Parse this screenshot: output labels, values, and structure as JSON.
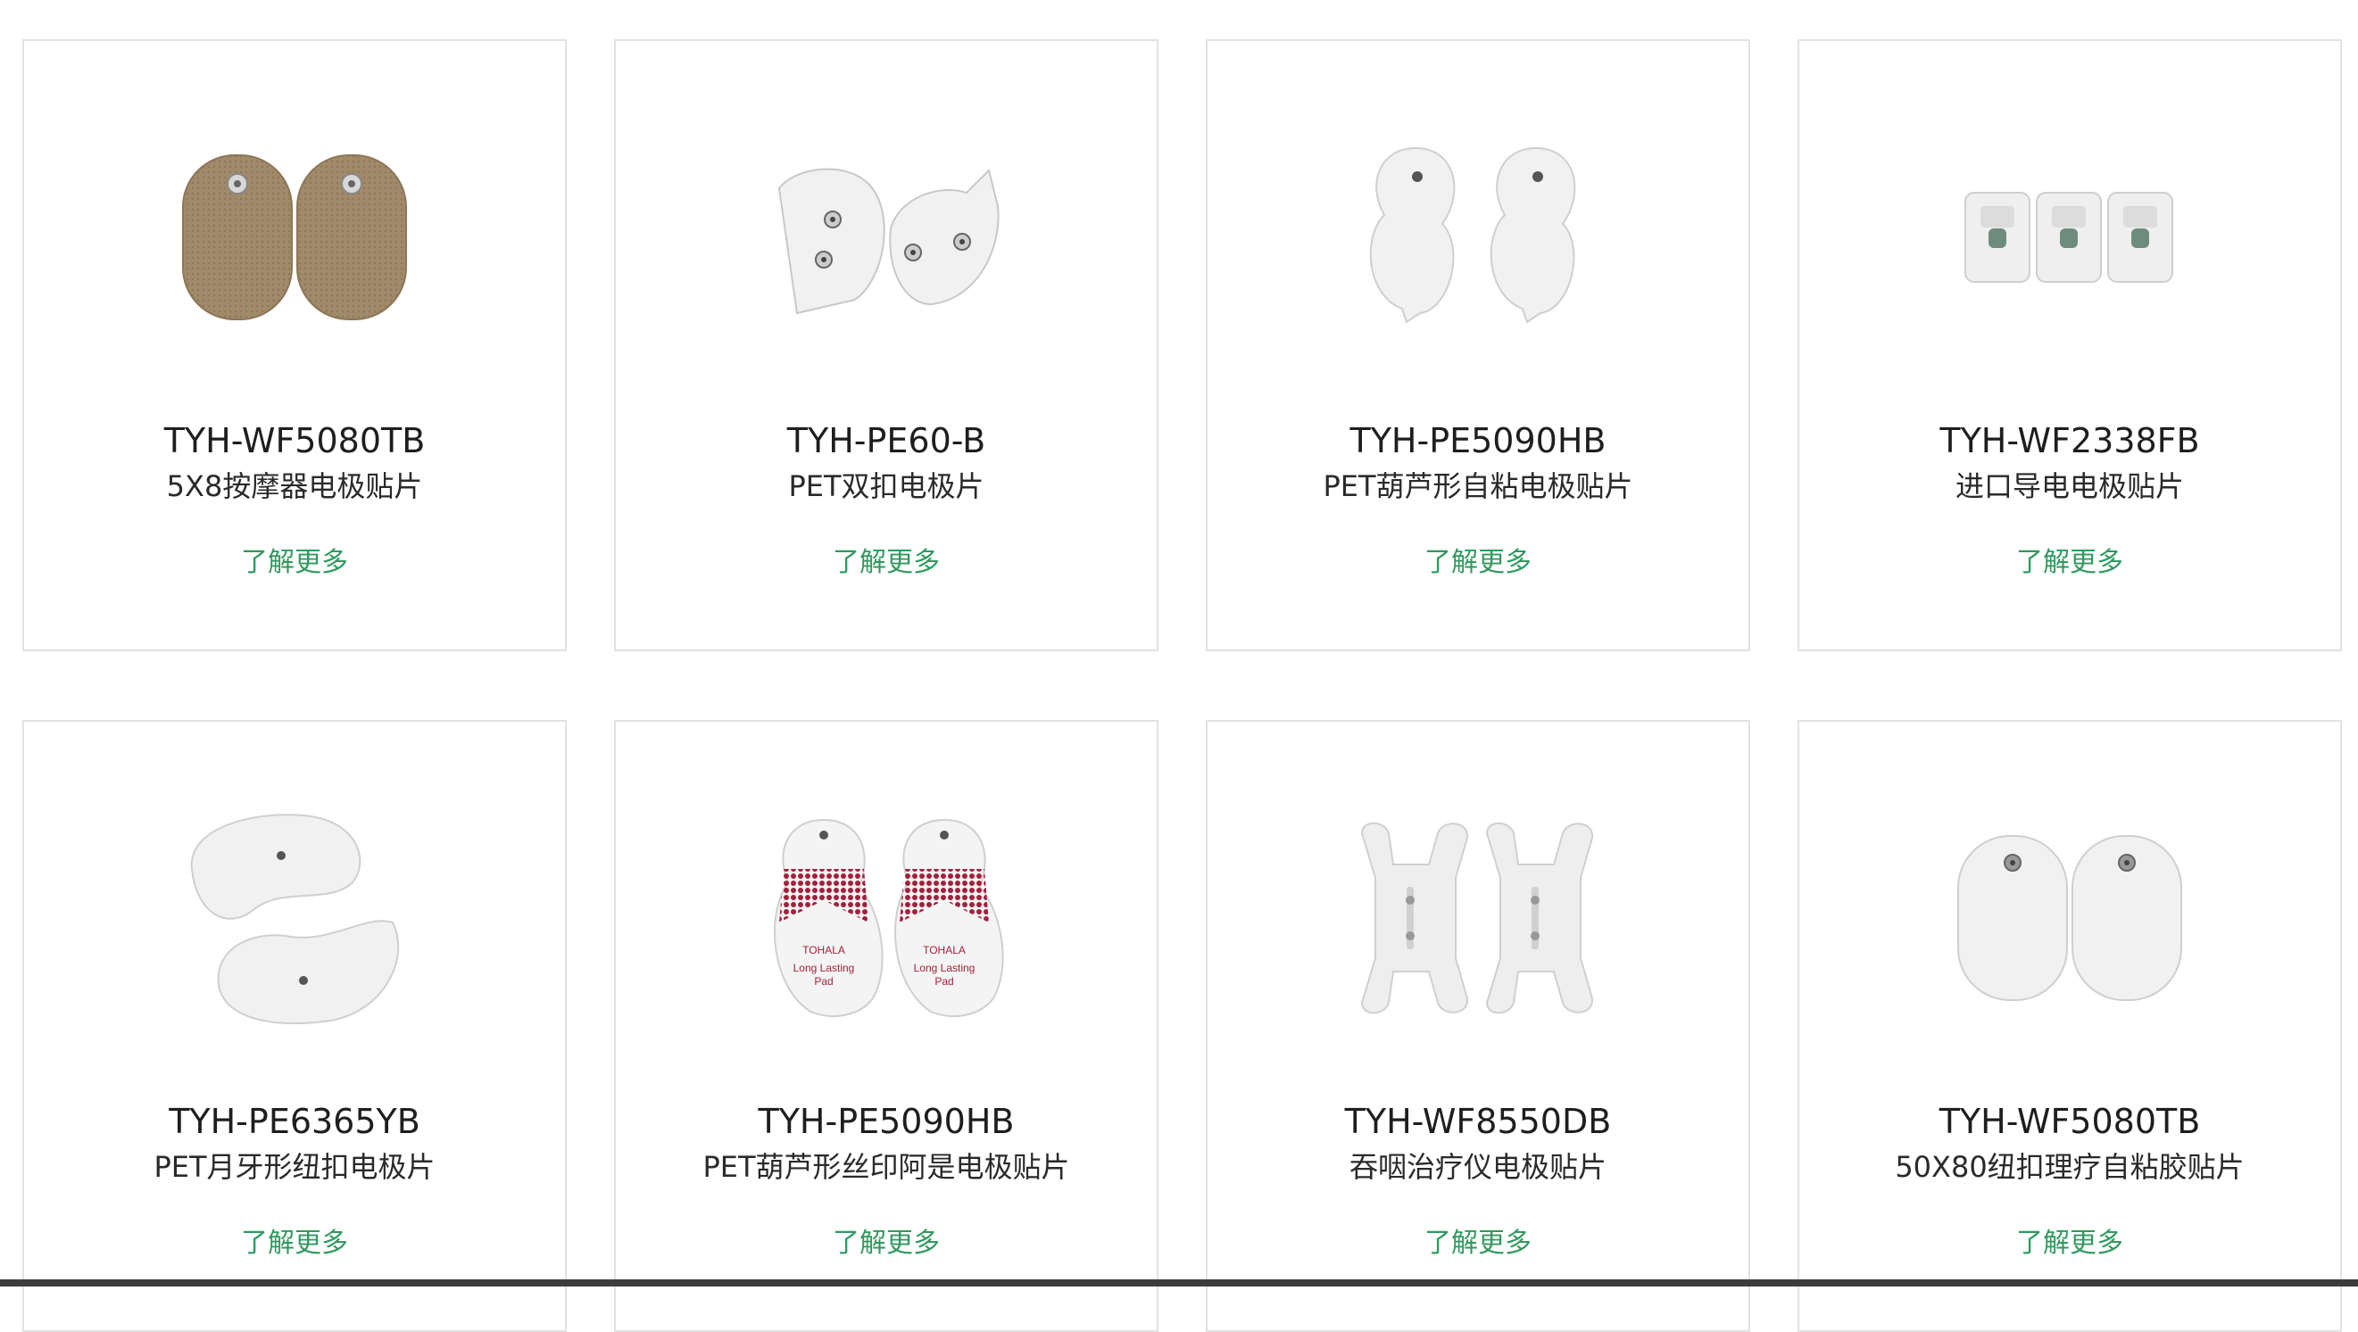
{
  "products": [
    {
      "model": "TYH-WF5080TB",
      "desc": "5X8按摩器电极贴片",
      "link": "了解更多",
      "image": "tan-oval-electrode-pads"
    },
    {
      "model": "TYH-PE60-B",
      "desc": "PET双扣电极片",
      "link": "了解更多",
      "image": "white-twin-snap-electrode-pads"
    },
    {
      "model": "TYH-PE5090HB",
      "desc": "PET葫芦形自粘电极贴片",
      "link": "了解更多",
      "image": "white-gourd-electrode-pads"
    },
    {
      "model": "TYH-WF2338FB",
      "desc": "进口导电电极贴片",
      "link": "了解更多",
      "image": "small-snap-electrode-strip"
    },
    {
      "model": "TYH-PE6365YB",
      "desc": "PET月牙形纽扣电极片",
      "link": "了解更多",
      "image": "crescent-electrode-pads"
    },
    {
      "model": "TYH-PE5090HB",
      "desc": "PET葫芦形丝印阿是电极贴片",
      "link": "了解更多",
      "image": "printed-gourd-electrode-pads",
      "pad_print": [
        "TOHALA",
        "Long Lasting",
        "Pad"
      ]
    },
    {
      "model": "TYH-WF8550DB",
      "desc": "吞咽治疗仪电极贴片",
      "link": "了解更多",
      "image": "h-shaped-electrode-pads"
    },
    {
      "model": "TYH-WF5080TB",
      "desc": "50X80纽扣理疗自粘胶贴片",
      "link": "了解更多",
      "image": "white-oval-electrode-pads"
    }
  ],
  "colors": {
    "link": "#2f9a5f",
    "border": "#e2e2e2",
    "pad_tan": "#a08a69",
    "pad_white": "#f1f1f1",
    "print_red": "#a3203c"
  }
}
